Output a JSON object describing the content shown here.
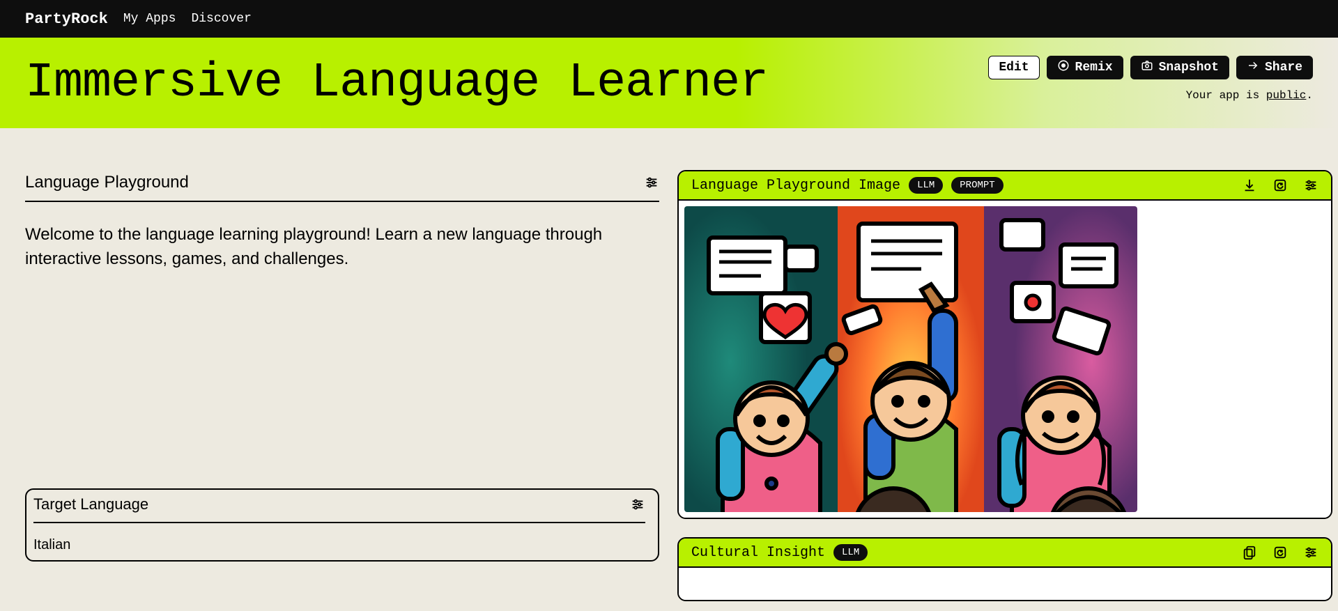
{
  "brand": "PartyRock",
  "nav": {
    "myApps": "My Apps",
    "discover": "Discover"
  },
  "hero": {
    "title": "Immersive Language Learner",
    "edit": "Edit",
    "remix": "Remix",
    "snapshot": "Snapshot",
    "share": "Share",
    "statusPrefix": "Your app is ",
    "statusLink": "public",
    "statusSuffix": "."
  },
  "playground": {
    "title": "Language Playground",
    "body": "Welcome to the language learning playground! Learn a new language through interactive lessons, games, and challenges."
  },
  "imageCard": {
    "title": "Language Playground Image",
    "tagLLM": "LLM",
    "tagPrompt": "PROMPT"
  },
  "target": {
    "title": "Target Language",
    "value": "Italian"
  },
  "cultural": {
    "title": "Cultural Insight",
    "tagLLM": "LLM"
  }
}
